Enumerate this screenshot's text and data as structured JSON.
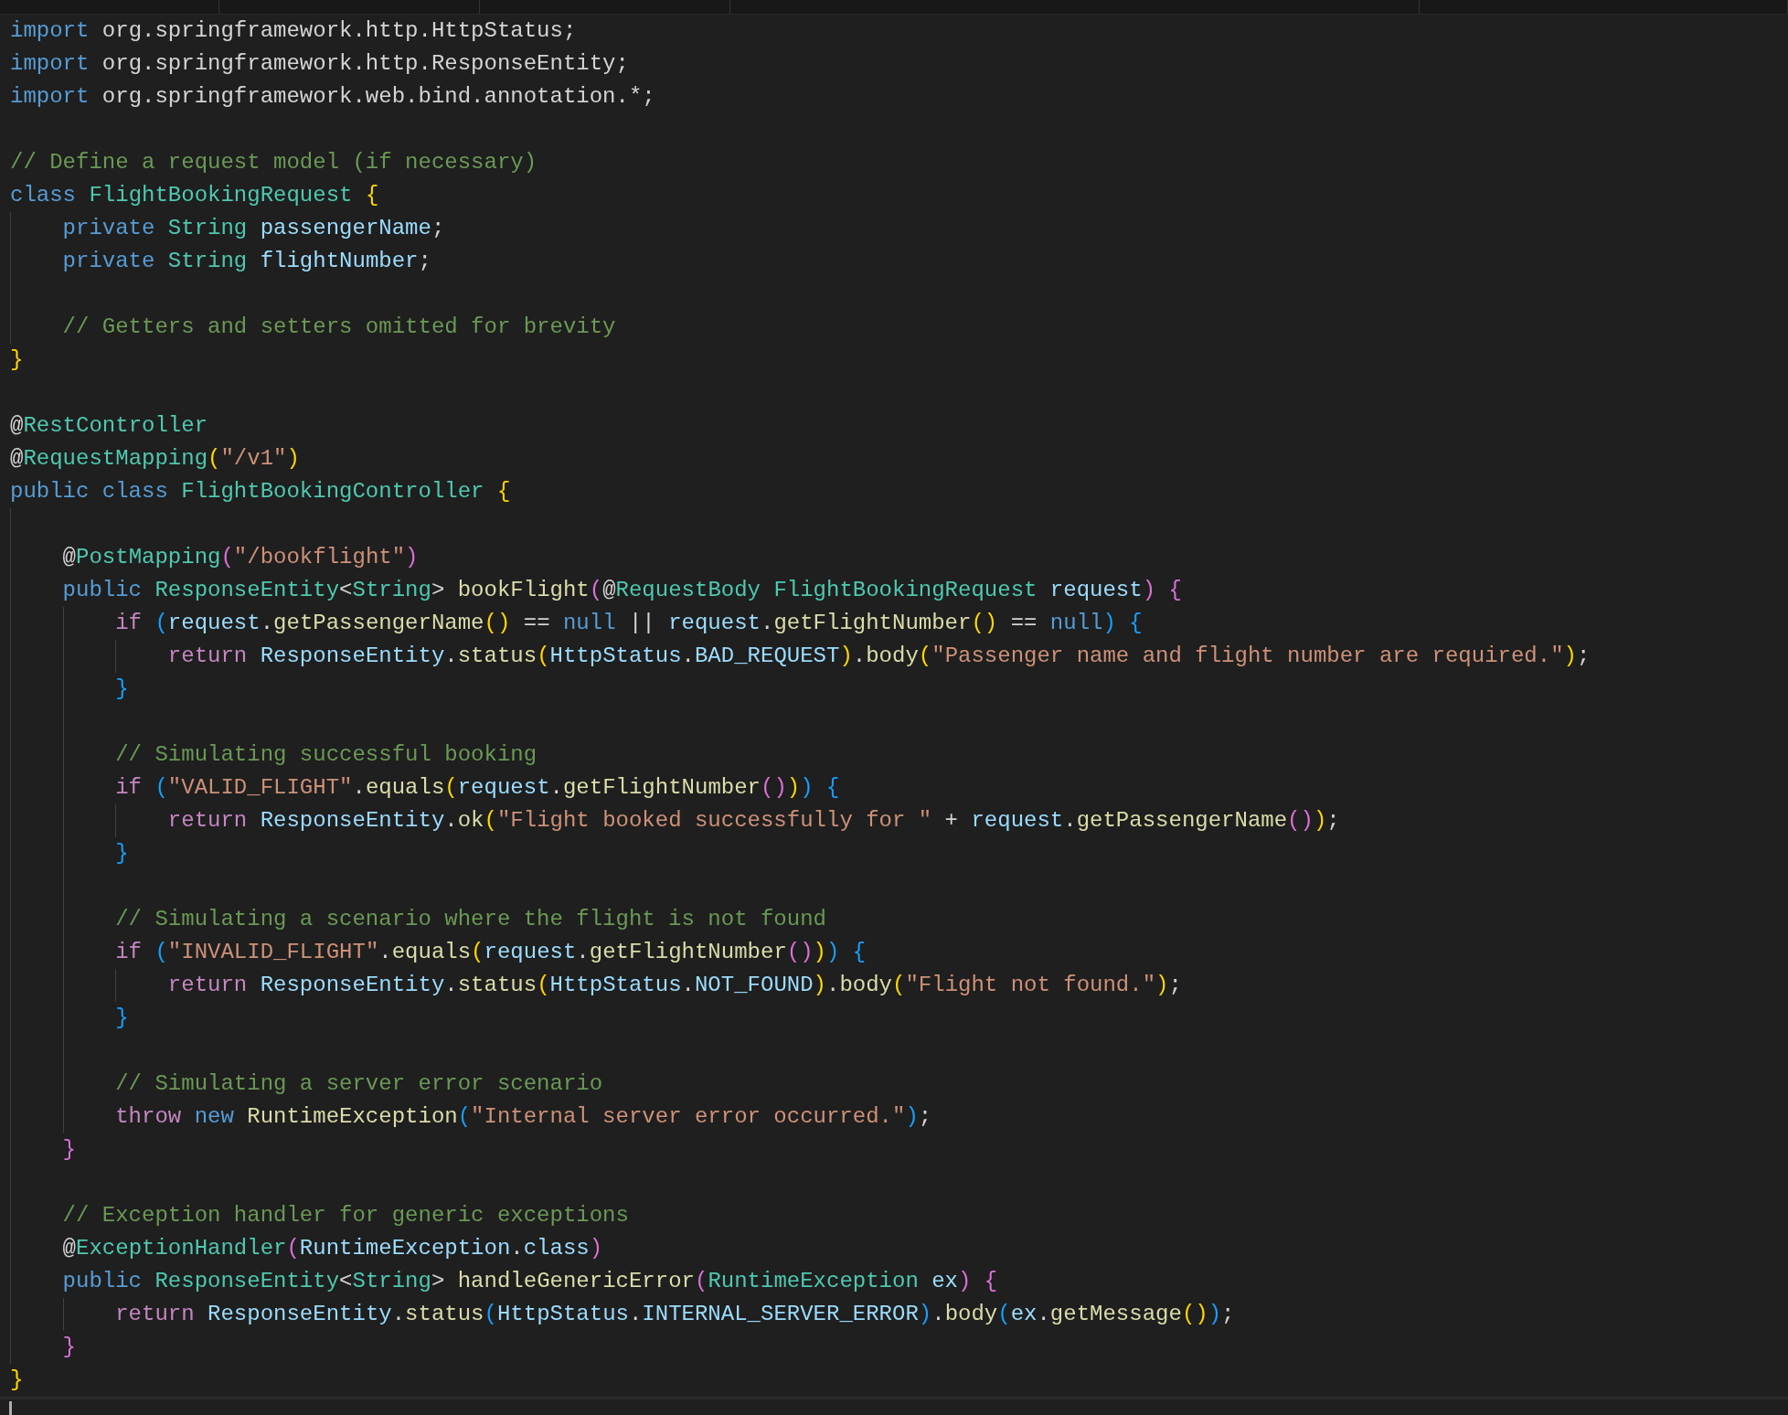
{
  "editor": {
    "lines": [
      {
        "kind": "code",
        "current": false,
        "tokens": [
          {
            "text": "import",
            "kind": "kw"
          },
          {
            "text": " org.springframework.http.HttpStatus;",
            "kind": "plain"
          }
        ]
      },
      {
        "kind": "code",
        "current": false,
        "tokens": [
          {
            "text": "import",
            "kind": "kw"
          },
          {
            "text": " org.springframework.http.ResponseEntity;",
            "kind": "plain"
          }
        ]
      },
      {
        "kind": "code",
        "current": false,
        "tokens": [
          {
            "text": "import",
            "kind": "kw"
          },
          {
            "text": " org.springframework.web.bind.annotation.*;",
            "kind": "plain"
          }
        ]
      },
      {
        "kind": "blank",
        "current": false
      },
      {
        "kind": "code",
        "current": false,
        "tokens": [
          {
            "text": "// Define a request model (if necessary)",
            "kind": "com"
          }
        ]
      },
      {
        "kind": "code",
        "current": false,
        "tokens": [
          {
            "text": "class ",
            "kind": "kw"
          },
          {
            "text": "FlightBookingRequest ",
            "kind": "type"
          },
          {
            "text": "{",
            "kind": "b1"
          }
        ]
      },
      {
        "kind": "code",
        "current": false,
        "tokens": [
          {
            "text": "    private ",
            "kind": "kw"
          },
          {
            "text": "String ",
            "kind": "type"
          },
          {
            "text": "passengerName",
            "kind": "var"
          },
          {
            "text": ";",
            "kind": "plain"
          }
        ]
      },
      {
        "kind": "code",
        "current": false,
        "tokens": [
          {
            "text": "    private ",
            "kind": "kw"
          },
          {
            "text": "String ",
            "kind": "type"
          },
          {
            "text": "flightNumber",
            "kind": "var"
          },
          {
            "text": ";",
            "kind": "plain"
          }
        ]
      },
      {
        "kind": "blank",
        "current": false
      },
      {
        "kind": "code",
        "current": false,
        "tokens": [
          {
            "text": "    // Getters and setters omitted for brevity",
            "kind": "com"
          }
        ]
      },
      {
        "kind": "code",
        "current": false,
        "tokens": [
          {
            "text": "}",
            "kind": "b1"
          }
        ]
      },
      {
        "kind": "blank",
        "current": false
      },
      {
        "kind": "code",
        "current": false,
        "tokens": [
          {
            "text": "@",
            "kind": "plain"
          },
          {
            "text": "RestController",
            "kind": "type"
          }
        ]
      },
      {
        "kind": "code",
        "current": false,
        "tokens": [
          {
            "text": "@",
            "kind": "plain"
          },
          {
            "text": "RequestMapping",
            "kind": "type"
          },
          {
            "text": "(",
            "kind": "b1"
          },
          {
            "text": "\"/v1\"",
            "kind": "str"
          },
          {
            "text": ")",
            "kind": "b1"
          }
        ]
      },
      {
        "kind": "code",
        "current": false,
        "tokens": [
          {
            "text": "public class ",
            "kind": "kw"
          },
          {
            "text": "FlightBookingController ",
            "kind": "type"
          },
          {
            "text": "{",
            "kind": "b1"
          }
        ]
      },
      {
        "kind": "blank",
        "current": false
      },
      {
        "kind": "code",
        "current": false,
        "tokens": [
          {
            "text": "    @",
            "kind": "plain"
          },
          {
            "text": "PostMapping",
            "kind": "type"
          },
          {
            "text": "(",
            "kind": "b2"
          },
          {
            "text": "\"/bookflight\"",
            "kind": "str"
          },
          {
            "text": ")",
            "kind": "b2"
          }
        ]
      },
      {
        "kind": "code",
        "current": false,
        "tokens": [
          {
            "text": "    public ",
            "kind": "kw"
          },
          {
            "text": "ResponseEntity",
            "kind": "type"
          },
          {
            "text": "<",
            "kind": "plain"
          },
          {
            "text": "String",
            "kind": "type"
          },
          {
            "text": "> ",
            "kind": "plain"
          },
          {
            "text": "bookFlight",
            "kind": "fn"
          },
          {
            "text": "(",
            "kind": "b2"
          },
          {
            "text": "@",
            "kind": "plain"
          },
          {
            "text": "RequestBody ",
            "kind": "type"
          },
          {
            "text": "FlightBookingRequest ",
            "kind": "type"
          },
          {
            "text": "request",
            "kind": "var"
          },
          {
            "text": ") ",
            "kind": "b2"
          },
          {
            "text": "{",
            "kind": "b2"
          }
        ]
      },
      {
        "kind": "code",
        "current": false,
        "tokens": [
          {
            "text": "        if ",
            "kind": "ctrl"
          },
          {
            "text": "(",
            "kind": "b3"
          },
          {
            "text": "request",
            "kind": "var"
          },
          {
            "text": ".",
            "kind": "plain"
          },
          {
            "text": "getPassengerName",
            "kind": "fn"
          },
          {
            "text": "()",
            "kind": "b1"
          },
          {
            "text": " == ",
            "kind": "plain"
          },
          {
            "text": "null",
            "kind": "kw"
          },
          {
            "text": " || ",
            "kind": "plain"
          },
          {
            "text": "request",
            "kind": "var"
          },
          {
            "text": ".",
            "kind": "plain"
          },
          {
            "text": "getFlightNumber",
            "kind": "fn"
          },
          {
            "text": "()",
            "kind": "b1"
          },
          {
            "text": " == ",
            "kind": "plain"
          },
          {
            "text": "null",
            "kind": "kw"
          },
          {
            "text": ") ",
            "kind": "b3"
          },
          {
            "text": "{",
            "kind": "b3"
          }
        ]
      },
      {
        "kind": "code",
        "current": false,
        "tokens": [
          {
            "text": "            return ",
            "kind": "ctrl"
          },
          {
            "text": "ResponseEntity",
            "kind": "var"
          },
          {
            "text": ".",
            "kind": "plain"
          },
          {
            "text": "status",
            "kind": "fn"
          },
          {
            "text": "(",
            "kind": "b1"
          },
          {
            "text": "HttpStatus",
            "kind": "var"
          },
          {
            "text": ".",
            "kind": "plain"
          },
          {
            "text": "BAD_REQUEST",
            "kind": "var"
          },
          {
            "text": ")",
            "kind": "b1"
          },
          {
            "text": ".",
            "kind": "plain"
          },
          {
            "text": "body",
            "kind": "fn"
          },
          {
            "text": "(",
            "kind": "b1"
          },
          {
            "text": "\"Passenger name and flight number are required.\"",
            "kind": "str"
          },
          {
            "text": ")",
            "kind": "b1"
          },
          {
            "text": ";",
            "kind": "plain"
          }
        ]
      },
      {
        "kind": "code",
        "current": false,
        "tokens": [
          {
            "text": "        }",
            "kind": "b3"
          }
        ]
      },
      {
        "kind": "blank",
        "current": false
      },
      {
        "kind": "code",
        "current": false,
        "tokens": [
          {
            "text": "        // Simulating successful booking",
            "kind": "com"
          }
        ]
      },
      {
        "kind": "code",
        "current": false,
        "tokens": [
          {
            "text": "        if ",
            "kind": "ctrl"
          },
          {
            "text": "(",
            "kind": "b3"
          },
          {
            "text": "\"VALID_FLIGHT\"",
            "kind": "str"
          },
          {
            "text": ".",
            "kind": "plain"
          },
          {
            "text": "equals",
            "kind": "fn"
          },
          {
            "text": "(",
            "kind": "b1"
          },
          {
            "text": "request",
            "kind": "var"
          },
          {
            "text": ".",
            "kind": "plain"
          },
          {
            "text": "getFlightNumber",
            "kind": "fn"
          },
          {
            "text": "()",
            "kind": "b2"
          },
          {
            "text": ")",
            "kind": "b1"
          },
          {
            "text": ") ",
            "kind": "b3"
          },
          {
            "text": "{",
            "kind": "b3"
          }
        ]
      },
      {
        "kind": "code",
        "current": false,
        "tokens": [
          {
            "text": "            return ",
            "kind": "ctrl"
          },
          {
            "text": "ResponseEntity",
            "kind": "var"
          },
          {
            "text": ".",
            "kind": "plain"
          },
          {
            "text": "ok",
            "kind": "fn"
          },
          {
            "text": "(",
            "kind": "b1"
          },
          {
            "text": "\"Flight booked successfully for \"",
            "kind": "str"
          },
          {
            "text": " + ",
            "kind": "plain"
          },
          {
            "text": "request",
            "kind": "var"
          },
          {
            "text": ".",
            "kind": "plain"
          },
          {
            "text": "getPassengerName",
            "kind": "fn"
          },
          {
            "text": "()",
            "kind": "b2"
          },
          {
            "text": ")",
            "kind": "b1"
          },
          {
            "text": ";",
            "kind": "plain"
          }
        ]
      },
      {
        "kind": "code",
        "current": false,
        "tokens": [
          {
            "text": "        }",
            "kind": "b3"
          }
        ]
      },
      {
        "kind": "blank",
        "current": false
      },
      {
        "kind": "code",
        "current": false,
        "tokens": [
          {
            "text": "        // Simulating a scenario where the flight is not found",
            "kind": "com"
          }
        ]
      },
      {
        "kind": "code",
        "current": false,
        "tokens": [
          {
            "text": "        if ",
            "kind": "ctrl"
          },
          {
            "text": "(",
            "kind": "b3"
          },
          {
            "text": "\"INVALID_FLIGHT\"",
            "kind": "str"
          },
          {
            "text": ".",
            "kind": "plain"
          },
          {
            "text": "equals",
            "kind": "fn"
          },
          {
            "text": "(",
            "kind": "b1"
          },
          {
            "text": "request",
            "kind": "var"
          },
          {
            "text": ".",
            "kind": "plain"
          },
          {
            "text": "getFlightNumber",
            "kind": "fn"
          },
          {
            "text": "()",
            "kind": "b2"
          },
          {
            "text": ")",
            "kind": "b1"
          },
          {
            "text": ") ",
            "kind": "b3"
          },
          {
            "text": "{",
            "kind": "b3"
          }
        ]
      },
      {
        "kind": "code",
        "current": false,
        "tokens": [
          {
            "text": "            return ",
            "kind": "ctrl"
          },
          {
            "text": "ResponseEntity",
            "kind": "var"
          },
          {
            "text": ".",
            "kind": "plain"
          },
          {
            "text": "status",
            "kind": "fn"
          },
          {
            "text": "(",
            "kind": "b1"
          },
          {
            "text": "HttpStatus",
            "kind": "var"
          },
          {
            "text": ".",
            "kind": "plain"
          },
          {
            "text": "NOT_FOUND",
            "kind": "var"
          },
          {
            "text": ")",
            "kind": "b1"
          },
          {
            "text": ".",
            "kind": "plain"
          },
          {
            "text": "body",
            "kind": "fn"
          },
          {
            "text": "(",
            "kind": "b1"
          },
          {
            "text": "\"Flight not found.\"",
            "kind": "str"
          },
          {
            "text": ")",
            "kind": "b1"
          },
          {
            "text": ";",
            "kind": "plain"
          }
        ]
      },
      {
        "kind": "code",
        "current": false,
        "tokens": [
          {
            "text": "        }",
            "kind": "b3"
          }
        ]
      },
      {
        "kind": "blank",
        "current": false
      },
      {
        "kind": "code",
        "current": false,
        "tokens": [
          {
            "text": "        // Simulating a server error scenario",
            "kind": "com"
          }
        ]
      },
      {
        "kind": "code",
        "current": false,
        "tokens": [
          {
            "text": "        throw ",
            "kind": "ctrl"
          },
          {
            "text": "new ",
            "kind": "kw"
          },
          {
            "text": "RuntimeException",
            "kind": "fn"
          },
          {
            "text": "(",
            "kind": "b3"
          },
          {
            "text": "\"Internal server error occurred.\"",
            "kind": "str"
          },
          {
            "text": ")",
            "kind": "b3"
          },
          {
            "text": ";",
            "kind": "plain"
          }
        ]
      },
      {
        "kind": "code",
        "current": false,
        "tokens": [
          {
            "text": "    }",
            "kind": "b2"
          }
        ]
      },
      {
        "kind": "blank",
        "current": false
      },
      {
        "kind": "code",
        "current": false,
        "tokens": [
          {
            "text": "    // Exception handler for generic exceptions",
            "kind": "com"
          }
        ]
      },
      {
        "kind": "code",
        "current": false,
        "tokens": [
          {
            "text": "    @",
            "kind": "plain"
          },
          {
            "text": "ExceptionHandler",
            "kind": "type"
          },
          {
            "text": "(",
            "kind": "b2"
          },
          {
            "text": "RuntimeException",
            "kind": "var"
          },
          {
            "text": ".",
            "kind": "plain"
          },
          {
            "text": "class",
            "kind": "var"
          },
          {
            "text": ")",
            "kind": "b2"
          }
        ]
      },
      {
        "kind": "code",
        "current": false,
        "tokens": [
          {
            "text": "    public ",
            "kind": "kw"
          },
          {
            "text": "ResponseEntity",
            "kind": "type"
          },
          {
            "text": "<",
            "kind": "plain"
          },
          {
            "text": "String",
            "kind": "type"
          },
          {
            "text": "> ",
            "kind": "plain"
          },
          {
            "text": "handleGenericError",
            "kind": "fn"
          },
          {
            "text": "(",
            "kind": "b2"
          },
          {
            "text": "RuntimeException ",
            "kind": "type"
          },
          {
            "text": "ex",
            "kind": "var"
          },
          {
            "text": ") ",
            "kind": "b2"
          },
          {
            "text": "{",
            "kind": "b2"
          }
        ]
      },
      {
        "kind": "code",
        "current": false,
        "tokens": [
          {
            "text": "        return ",
            "kind": "ctrl"
          },
          {
            "text": "ResponseEntity",
            "kind": "var"
          },
          {
            "text": ".",
            "kind": "plain"
          },
          {
            "text": "status",
            "kind": "fn"
          },
          {
            "text": "(",
            "kind": "b3"
          },
          {
            "text": "HttpStatus",
            "kind": "var"
          },
          {
            "text": ".",
            "kind": "plain"
          },
          {
            "text": "INTERNAL_SERVER_ERROR",
            "kind": "var"
          },
          {
            "text": ")",
            "kind": "b3"
          },
          {
            "text": ".",
            "kind": "plain"
          },
          {
            "text": "body",
            "kind": "fn"
          },
          {
            "text": "(",
            "kind": "b3"
          },
          {
            "text": "ex",
            "kind": "var"
          },
          {
            "text": ".",
            "kind": "plain"
          },
          {
            "text": "getMessage",
            "kind": "fn"
          },
          {
            "text": "()",
            "kind": "b1"
          },
          {
            "text": ")",
            "kind": "b3"
          },
          {
            "text": ";",
            "kind": "plain"
          }
        ]
      },
      {
        "kind": "code",
        "current": false,
        "tokens": [
          {
            "text": "    }",
            "kind": "b2"
          }
        ]
      },
      {
        "kind": "code",
        "current": false,
        "tokens": [
          {
            "text": "}",
            "kind": "b1"
          }
        ]
      },
      {
        "kind": "blank",
        "current": true
      }
    ]
  }
}
